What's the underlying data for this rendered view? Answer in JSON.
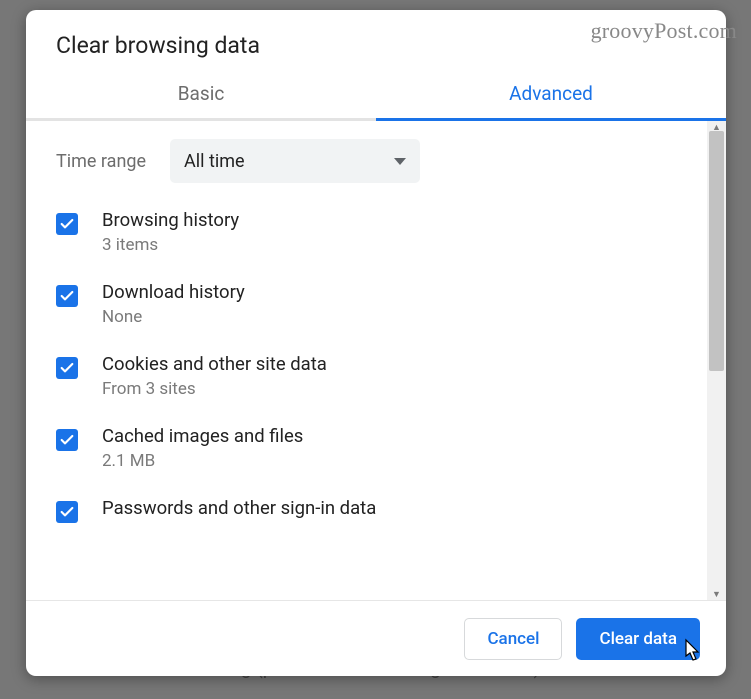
{
  "watermark": "groovyPost.com",
  "background_obscured_text": "Safe Browsing (protection from dangerous sites) and other se",
  "dialog": {
    "title": "Clear browsing data",
    "tabs": {
      "basic": "Basic",
      "advanced": "Advanced",
      "active": "advanced"
    },
    "time_range": {
      "label": "Time range",
      "selected": "All time"
    },
    "items": [
      {
        "title": "Browsing history",
        "subtitle": "3 items",
        "checked": true
      },
      {
        "title": "Download history",
        "subtitle": "None",
        "checked": true
      },
      {
        "title": "Cookies and other site data",
        "subtitle": "From 3 sites",
        "checked": true
      },
      {
        "title": "Cached images and files",
        "subtitle": "2.1 MB",
        "checked": true
      },
      {
        "title": "Passwords and other sign-in data",
        "subtitle": "",
        "checked": true
      }
    ],
    "buttons": {
      "cancel": "Cancel",
      "confirm": "Clear data"
    }
  }
}
